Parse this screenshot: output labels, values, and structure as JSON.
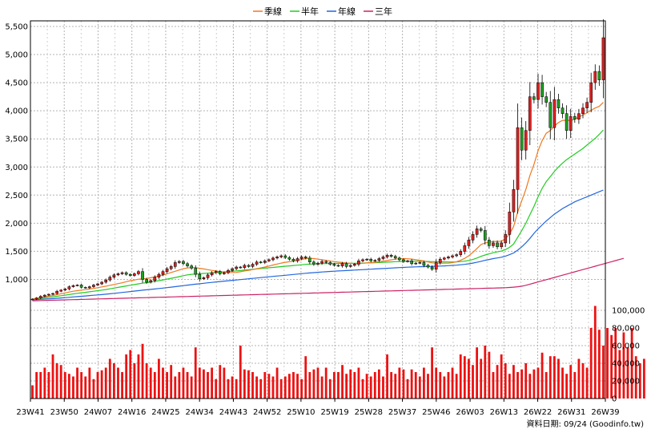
{
  "footer": {
    "source": "資料日期: 09/24  (Goodinfo.tw)"
  },
  "colors": {
    "up_candle": "#e02020",
    "down_candle": "#1ea01e",
    "volume_bar": "#ee1111",
    "quarter_ma": "#f07820",
    "half_year_ma": "#22cc22",
    "year_ma": "#2266dd",
    "three_year_ma": "#cc2266"
  },
  "chart_data": {
    "type": "candlestick",
    "title": "",
    "legend": [
      "季線",
      "半年",
      "年線",
      "三年"
    ],
    "legend_position": "top-center",
    "grid": true,
    "price_axis": {
      "position": "left",
      "ylim": [
        550,
        5600
      ],
      "ticks": [
        1000,
        1500,
        2000,
        2500,
        3000,
        3500,
        4000,
        4500,
        5000,
        5500
      ],
      "tick_labels": [
        "1,000",
        "1,500",
        "2,000",
        "2,500",
        "3,000",
        "3,500",
        "4,000",
        "4,500",
        "5,000",
        "5,500"
      ]
    },
    "volume_axis": {
      "position": "right",
      "ylim": [
        0,
        110000
      ],
      "ticks": [
        0,
        20000,
        40000,
        60000,
        80000,
        100000
      ],
      "tick_labels": [
        "0",
        "20,000",
        "40,000",
        "60,000",
        "80,000",
        "100,000"
      ]
    },
    "x_tick_labels": [
      "23W41",
      "23W50",
      "24W07",
      "24W16",
      "24W25",
      "24W34",
      "24W43",
      "24W52",
      "25W10",
      "25W19",
      "25W28",
      "25W37",
      "25W46",
      "26W03",
      "26W13",
      "26W22",
      "26W31",
      "26W39"
    ],
    "close": [
      650,
      670,
      700,
      720,
      735,
      750,
      790,
      810,
      830,
      870,
      890,
      900,
      860,
      850,
      870,
      900,
      920,
      950,
      990,
      1040,
      1080,
      1100,
      1120,
      1090,
      1070,
      1100,
      1140,
      1000,
      950,
      980,
      1040,
      1090,
      1140,
      1190,
      1230,
      1300,
      1320,
      1280,
      1240,
      1200,
      1090,
      1010,
      1030,
      1080,
      1120,
      1140,
      1100,
      1120,
      1160,
      1190,
      1220,
      1210,
      1250,
      1230,
      1270,
      1310,
      1300,
      1330,
      1350,
      1380,
      1400,
      1420,
      1390,
      1360,
      1330,
      1370,
      1400,
      1380,
      1310,
      1270,
      1290,
      1320,
      1300,
      1270,
      1250,
      1240,
      1280,
      1230,
      1250,
      1270,
      1330,
      1350,
      1360,
      1330,
      1340,
      1370,
      1400,
      1430,
      1410,
      1380,
      1350,
      1320,
      1330,
      1280,
      1290,
      1300,
      1250,
      1220,
      1180,
      1300,
      1360,
      1380,
      1400,
      1420,
      1440,
      1500,
      1600,
      1700,
      1800,
      1900,
      1870,
      1700,
      1600,
      1650,
      1580,
      1650,
      1800,
      2200,
      2600,
      3700,
      3300,
      3650,
      4250,
      4200,
      4500,
      4250,
      4150,
      3700,
      4200,
      4050,
      3950,
      3650,
      3900,
      3850,
      3950,
      4050,
      4150,
      4500,
      4700,
      4550,
      5300
    ],
    "ma_quarter": [
      650,
      662,
      677,
      690,
      703,
      714,
      730,
      745,
      760,
      775,
      790,
      800,
      810,
      818,
      830,
      840,
      853,
      867,
      880,
      895,
      910,
      925,
      940,
      960,
      976,
      990,
      1004,
      1008,
      1016,
      1030,
      1044,
      1060,
      1078,
      1100,
      1123,
      1145,
      1168,
      1190,
      1203,
      1210,
      1210,
      1198,
      1186,
      1174,
      1160,
      1150,
      1139,
      1130,
      1125,
      1124,
      1125,
      1136,
      1150,
      1160,
      1175,
      1190,
      1205,
      1220,
      1238,
      1256,
      1273,
      1290,
      1305,
      1315,
      1325,
      1340,
      1355,
      1370,
      1376,
      1370,
      1360,
      1350,
      1339,
      1326,
      1318,
      1307,
      1300,
      1292,
      1286,
      1281,
      1280,
      1288,
      1294,
      1299,
      1306,
      1314,
      1324,
      1336,
      1349,
      1360,
      1367,
      1370,
      1368,
      1362,
      1351,
      1340,
      1327,
      1310,
      1294,
      1289,
      1288,
      1289,
      1291,
      1299,
      1315,
      1340,
      1375,
      1420,
      1480,
      1550,
      1620,
      1650,
      1660,
      1675,
      1676,
      1680,
      1720,
      1810,
      1940,
      2200,
      2400,
      2600,
      2850,
      3050,
      3290,
      3470,
      3600,
      3650,
      3730,
      3790,
      3830,
      3830,
      3830,
      3850,
      3890,
      3925,
      3965,
      4010,
      4050,
      4080,
      4150
    ],
    "ma_half": [
      650,
      656,
      664,
      672,
      681,
      690,
      700,
      710,
      720,
      731,
      742,
      752,
      762,
      770,
      780,
      790,
      800,
      810,
      820,
      832,
      845,
      858,
      871,
      884,
      896,
      908,
      921,
      932,
      943,
      955,
      966,
      978,
      991,
      1005,
      1019,
      1034,
      1050,
      1066,
      1080,
      1091,
      1097,
      1101,
      1106,
      1111,
      1117,
      1123,
      1128,
      1134,
      1140,
      1146,
      1152,
      1158,
      1165,
      1172,
      1179,
      1186,
      1193,
      1200,
      1207,
      1214,
      1221,
      1228,
      1235,
      1241,
      1247,
      1253,
      1260,
      1267,
      1272,
      1275,
      1278,
      1280,
      1282,
      1283,
      1284,
      1285,
      1286,
      1286,
      1287,
      1288,
      1289,
      1291,
      1293,
      1295,
      1297,
      1300,
      1304,
      1308,
      1312,
      1316,
      1319,
      1322,
      1323,
      1324,
      1323,
      1322,
      1321,
      1319,
      1316,
      1315,
      1313,
      1312,
      1310,
      1310,
      1312,
      1317,
      1325,
      1338,
      1355,
      1380,
      1410,
      1435,
      1455,
      1475,
      1490,
      1505,
      1530,
      1570,
      1630,
      1750,
      1870,
      2000,
      2150,
      2300,
      2470,
      2620,
      2740,
      2830,
      2920,
      3000,
      3070,
      3130,
      3180,
      3230,
      3280,
      3330,
      3390,
      3450,
      3510,
      3580,
      3660
    ],
    "ma_year": [
      640,
      642,
      646,
      650,
      654,
      658,
      664,
      670,
      675,
      681,
      688,
      694,
      700,
      706,
      712,
      718,
      724,
      730,
      737,
      744,
      752,
      760,
      768,
      776,
      784,
      792,
      800,
      808,
      815,
      822,
      830,
      838,
      846,
      854,
      862,
      871,
      880,
      889,
      898,
      907,
      915,
      923,
      931,
      939,
      947,
      955,
      962,
      969,
      976,
      983,
      990,
      997,
      1004,
      1011,
      1018,
      1025,
      1032,
      1039,
      1046,
      1053,
      1060,
      1067,
      1074,
      1081,
      1088,
      1095,
      1102,
      1109,
      1115,
      1121,
      1127,
      1132,
      1137,
      1142,
      1146,
      1150,
      1154,
      1158,
      1162,
      1166,
      1170,
      1174,
      1178,
      1182,
      1186,
      1190,
      1194,
      1198,
      1202,
      1206,
      1210,
      1214,
      1217,
      1220,
      1223,
      1226,
      1228,
      1230,
      1232,
      1235,
      1238,
      1241,
      1245,
      1249,
      1254,
      1260,
      1268,
      1278,
      1290,
      1305,
      1322,
      1340,
      1355,
      1370,
      1382,
      1395,
      1415,
      1440,
      1470,
      1520,
      1580,
      1650,
      1730,
      1820,
      1900,
      1970,
      2040,
      2100,
      2160,
      2210,
      2260,
      2300,
      2340,
      2380,
      2410,
      2440,
      2470,
      2500,
      2530,
      2560,
      2590
    ],
    "ma_three_year": [
      620,
      622,
      624,
      626,
      628,
      630,
      632,
      634,
      636,
      638,
      640,
      642,
      644,
      646,
      648,
      650,
      652,
      654,
      656,
      658,
      660,
      662,
      664,
      666,
      668,
      670,
      672,
      674,
      676,
      678,
      680,
      682,
      684,
      686,
      688,
      690,
      692,
      694,
      696,
      698,
      700,
      702,
      704,
      706,
      708,
      710,
      712,
      714,
      716,
      718,
      720,
      722,
      724,
      726,
      728,
      730,
      732,
      734,
      736,
      738,
      740,
      742,
      744,
      746,
      748,
      750,
      752,
      754,
      756,
      758,
      760,
      762,
      764,
      766,
      768,
      770,
      772,
      774,
      776,
      778,
      780,
      782,
      784,
      786,
      788,
      790,
      792,
      794,
      796,
      798,
      800,
      802,
      804,
      806,
      808,
      810,
      812,
      814,
      816,
      818,
      820,
      822,
      824,
      826,
      828,
      830,
      832,
      834,
      836,
      838,
      840,
      842,
      844,
      846,
      848,
      850,
      853,
      857,
      862,
      870,
      880,
      895,
      915,
      935,
      955,
      975,
      995,
      1015,
      1035,
      1055,
      1075,
      1095,
      1115,
      1135,
      1155,
      1175,
      1195,
      1215,
      1235,
      1255,
      1275,
      1295,
      1315,
      1335,
      1355,
      1375
    ],
    "volume": [
      15000,
      30000,
      30000,
      35000,
      30000,
      50000,
      40000,
      38000,
      30000,
      28000,
      25000,
      35000,
      30000,
      25000,
      35000,
      22000,
      30000,
      32000,
      35000,
      45000,
      40000,
      35000,
      30000,
      50000,
      55000,
      40000,
      50000,
      62000,
      40000,
      35000,
      30000,
      45000,
      35000,
      30000,
      38000,
      25000,
      30000,
      35000,
      30000,
      25000,
      58000,
      35000,
      33000,
      30000,
      35000,
      22000,
      38000,
      35000,
      22000,
      25000,
      22000,
      60000,
      33000,
      32000,
      30000,
      25000,
      22000,
      30000,
      28000,
      25000,
      35000,
      22000,
      25000,
      28000,
      30000,
      28000,
      22000,
      48000,
      30000,
      33000,
      35000,
      25000,
      35000,
      22000,
      30000,
      30000,
      38000,
      28000,
      33000,
      30000,
      35000,
      22000,
      28000,
      25000,
      30000,
      33000,
      25000,
      50000,
      30000,
      28000,
      35000,
      33000,
      22000,
      33000,
      30000,
      25000,
      35000,
      28000,
      58000,
      35000,
      30000,
      25000,
      30000,
      35000,
      28000,
      50000,
      48000,
      45000,
      38000,
      58000,
      45000,
      60000,
      53000,
      30000,
      38000,
      50000,
      40000,
      28000,
      38000,
      30000,
      33000,
      40000,
      28000,
      33000,
      35000,
      52000,
      30000,
      48000,
      48000,
      45000,
      35000,
      28000,
      38000,
      30000,
      45000,
      40000,
      35000,
      80000,
      105000,
      78000,
      60000,
      80000,
      72000,
      80000,
      55000,
      75000,
      58000,
      80000,
      48000,
      40000,
      45000,
      52000,
      35000,
      42000,
      38000,
      48000,
      32000,
      40000,
      38000,
      55000,
      40000,
      38000,
      42000,
      35000,
      35000,
      36000
    ]
  }
}
